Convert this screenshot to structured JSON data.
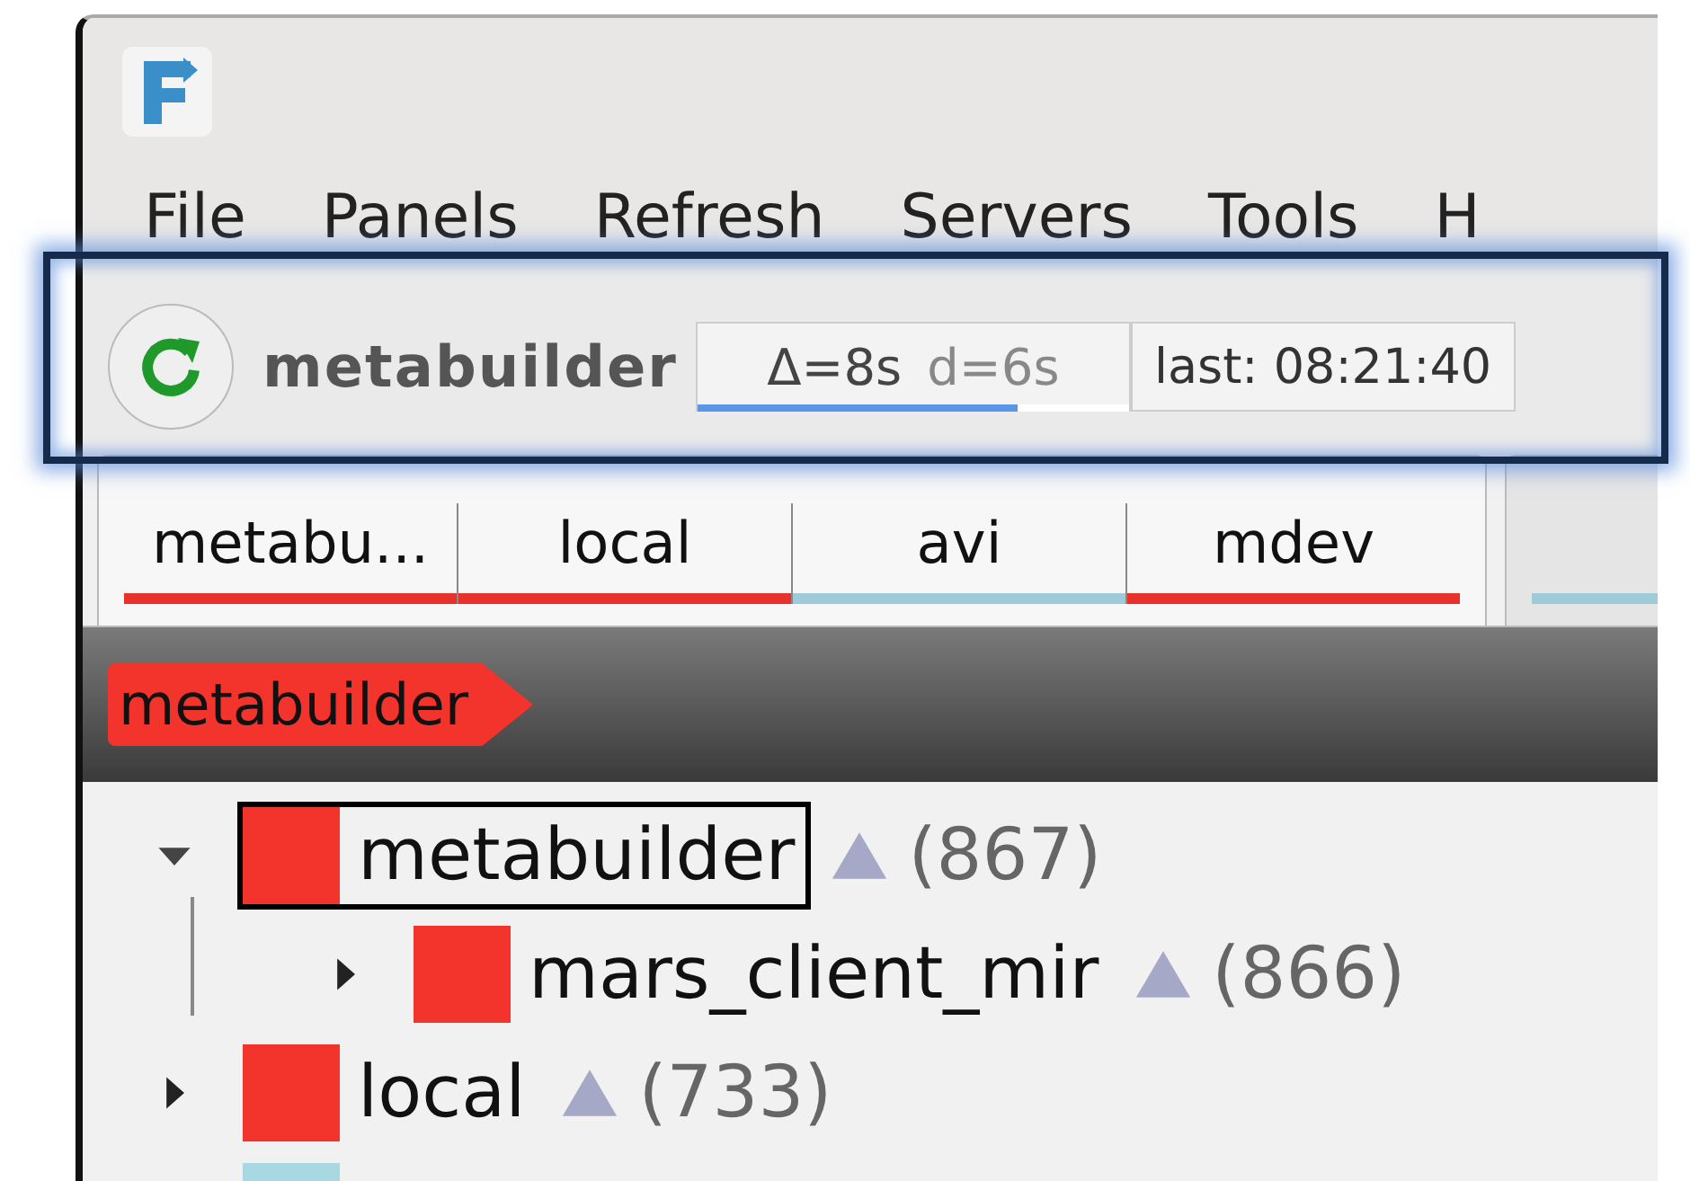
{
  "menu": [
    "File",
    "Panels",
    "Refresh",
    "Servers",
    "Tools",
    "H"
  ],
  "toolbar": {
    "server": "metabuilder",
    "delta": "Δ=8s",
    "duration": "d=6s",
    "level": 0.74,
    "last": "last: 08:21:40"
  },
  "tab_groups": [
    {
      "selected": true,
      "tabs": [
        {
          "label": "metabu...",
          "color": "#e8312a"
        },
        {
          "label": "local",
          "color": "#e8312a"
        },
        {
          "label": "avi",
          "color": "#9fcbd9"
        },
        {
          "label": "mdev",
          "color": "#e8312a"
        }
      ]
    },
    {
      "selected": false,
      "tabs": [
        {
          "color": "#9fcbd9"
        }
      ]
    }
  ],
  "breadcrumb": {
    "label": "metabuilder",
    "color": "#f2342c"
  },
  "tree": [
    {
      "label": "metabuilder",
      "count": "(867)",
      "color": "#f2342c",
      "expanded": true,
      "selected": true,
      "children": [
        {
          "label": "mars_client_mir",
          "count": "(866)",
          "color": "#f2342c",
          "expanded": false,
          "selected": false
        }
      ]
    },
    {
      "label": "local",
      "count": "(733)",
      "color": "#f2342c",
      "expanded": false,
      "selected": false
    },
    {
      "color": "#a8d8e2",
      "selected": false
    }
  ]
}
